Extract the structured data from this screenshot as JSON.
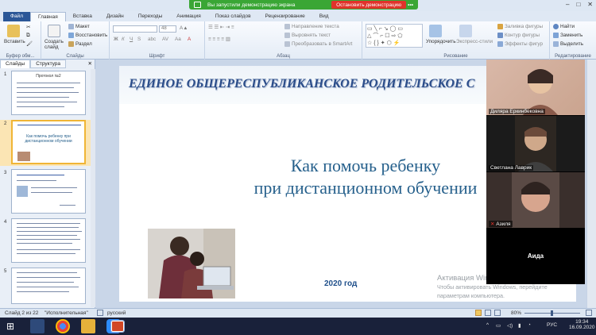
{
  "screen_share_bar": {
    "message": "Вы запустили демонстрацию экрана",
    "stop_label": "Остановить демонстрацию",
    "more": "•••",
    "accent": "#3aa635",
    "stop_color": "#e0332b"
  },
  "ribbon_tabs": [
    "Файл",
    "Главная",
    "Вставка",
    "Дизайн",
    "Переходы",
    "Анимация",
    "Показ слайдов",
    "Рецензирование",
    "Вид"
  ],
  "ribbon": {
    "clipboard": {
      "paste": "Вставить",
      "label": "Буфер обм..."
    },
    "slides": {
      "create": "Создать слайд",
      "layout": "Макет",
      "reset": "Восстановить",
      "section": "Раздел",
      "label": "Слайды"
    },
    "font": {
      "size": "48",
      "label": "Шрифт"
    },
    "paragraph": {
      "text_direction": "Направление текста",
      "align_text": "Выровнять текст",
      "smartart": "Преобразовать в SmartArt",
      "label": "Абзац"
    },
    "drawing": {
      "arrange": "Упорядочить",
      "quick_styles": "Экспресс-стили",
      "fill": "Заливка фигуры",
      "outline": "Контур фигуры",
      "effects": "Эффекты фигур",
      "label": "Рисование"
    },
    "editing": {
      "find": "Найти",
      "replace": "Заменить",
      "select": "Выделить",
      "label": "Редактирование"
    }
  },
  "side_panel": {
    "tabs": [
      "Слайды",
      "Структура"
    ],
    "thumbnails": [
      {
        "num": "1",
        "title": "Протокол №2"
      },
      {
        "num": "2",
        "title": "Как помочь ребенку при дистанционном обучении"
      },
      {
        "num": "3",
        "title": ""
      },
      {
        "num": "4",
        "title": ""
      },
      {
        "num": "5",
        "title": ""
      }
    ]
  },
  "slide": {
    "header": "ЕДИНОЕ ОБЩЕРЕСПУБЛИКАНСКОЕ РОДИТЕЛЬСКОЕ С",
    "title_line1": "Как помочь ребенку",
    "title_line2": "при дистанционном обучении",
    "year": "2020 год"
  },
  "windows_activation": {
    "title": "Активация Windows",
    "line1": "Чтобы активировать Windows, перейдите",
    "line2": "параметрам компьютера."
  },
  "zoom": {
    "participants": [
      {
        "name": "Диляра Еркинбековна"
      },
      {
        "name": "Светлана Лаврик"
      },
      {
        "name": "Азиля"
      },
      {
        "name": "Аида"
      }
    ]
  },
  "status_bar": {
    "slide_info": "Слайд 2 из 22",
    "theme": "\"Исполнительная\"",
    "language": "русский",
    "zoom_level": "80%"
  },
  "taskbar": {
    "tray_lang": "РУС",
    "time": "19:34",
    "date": "16.09.2020"
  }
}
